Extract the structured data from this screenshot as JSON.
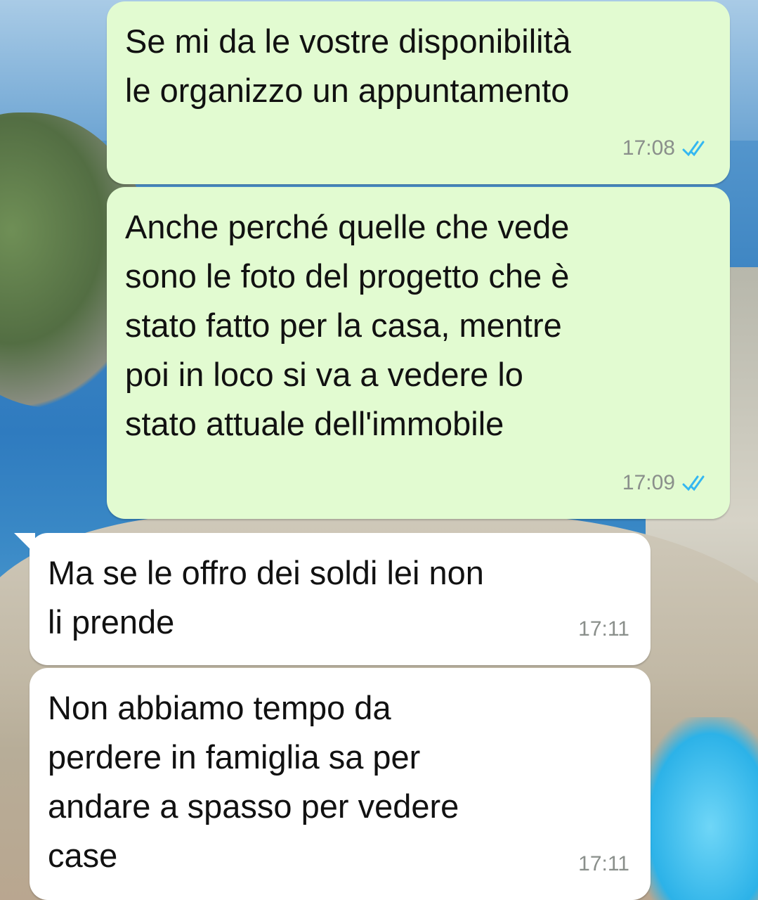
{
  "messages": [
    {
      "direction": "outgoing",
      "text": "Se mi da le vostre disponibilità\nle organizzo un appuntamento",
      "time": "17:08",
      "status_icon": "double-check-read-icon"
    },
    {
      "direction": "outgoing",
      "text": "Anche perché quelle che vede\nsono le foto del progetto che è\nstato fatto per la casa, mentre\npoi in loco si va a vedere lo\nstato attuale dell'immobile",
      "time": "17:09",
      "status_icon": "double-check-read-icon"
    },
    {
      "direction": "incoming",
      "text": "Ma se le offro dei soldi lei non\nli prende",
      "time": "17:11"
    },
    {
      "direction": "incoming",
      "text": "Non abbiamo tempo da\nperdere in famiglia sa per\nandare a spasso per vedere\ncase",
      "time": "17:11"
    }
  ],
  "colors": {
    "outgoing_bubble": "#e2fbd1",
    "incoming_bubble": "#ffffff",
    "read_ticks": "#34b7f1",
    "timestamp": "#8a8f8b"
  }
}
